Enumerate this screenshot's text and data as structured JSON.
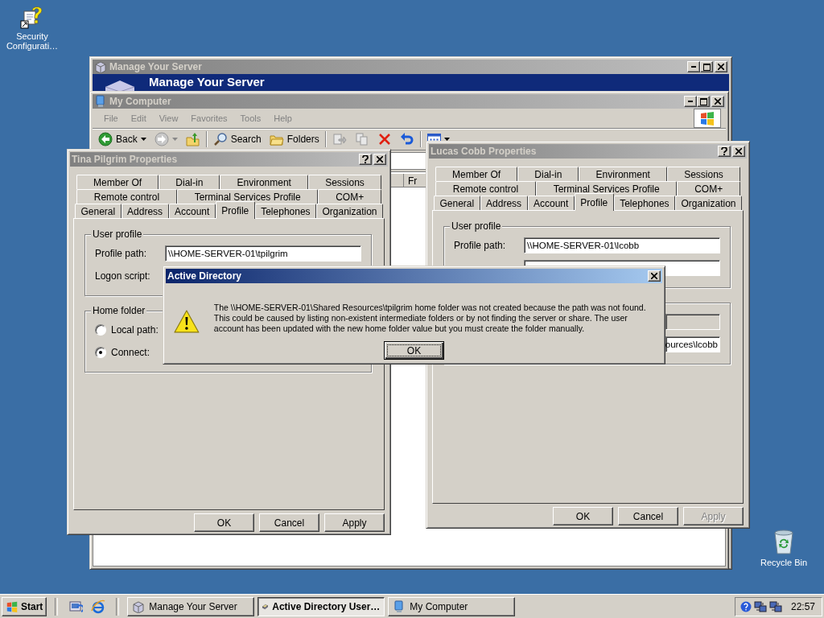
{
  "desktop": {
    "icons": [
      {
        "kind": "security",
        "label": "Security Configurati…"
      },
      {
        "kind": "recycle",
        "label": "Recycle Bin"
      }
    ]
  },
  "manage_your_server": {
    "title": "Manage Your Server",
    "banner_title": "Manage Your Server"
  },
  "my_computer": {
    "title": "My Computer",
    "menu": [
      "File",
      "Edit",
      "View",
      "Favorites",
      "Tools",
      "Help"
    ],
    "toolbar": [
      {
        "kind": "back",
        "label": "Back"
      },
      {
        "kind": "forward"
      },
      {
        "kind": "up"
      },
      {
        "kind": "separator"
      },
      {
        "kind": "search",
        "label": "Search"
      },
      {
        "kind": "folders",
        "label": "Folders"
      },
      {
        "kind": "separator"
      },
      {
        "kind": "move"
      },
      {
        "kind": "copy"
      },
      {
        "kind": "delete"
      },
      {
        "kind": "undo"
      },
      {
        "kind": "separator"
      },
      {
        "kind": "views"
      }
    ],
    "column_2": "Fr"
  },
  "dialogs": [
    {
      "title": "Tina Pilgrim Properties",
      "tab_rows": [
        [
          {
            "label": "Member Of",
            "selected": false
          },
          {
            "label": "Dial-in",
            "selected": false
          },
          {
            "label": "Environment",
            "selected": false
          },
          {
            "label": "Sessions",
            "selected": false
          }
        ],
        [
          {
            "label": "Remote control",
            "selected": false
          },
          {
            "label": "Terminal Services Profile",
            "selected": false
          },
          {
            "label": "COM+",
            "selected": false
          }
        ],
        [
          {
            "label": "General",
            "selected": false
          },
          {
            "label": "Address",
            "selected": false
          },
          {
            "label": "Account",
            "selected": false
          },
          {
            "label": "Profile",
            "selected": true
          },
          {
            "label": "Telephones",
            "selected": false
          },
          {
            "label": "Organization",
            "selected": false
          }
        ]
      ],
      "user_profile": {
        "label": "User profile",
        "items": [
          {
            "kind": "field",
            "label": "Profile path:",
            "value": "\\\\HOME-SERVER-01\\tpilgrim",
            "disabled": false
          },
          {
            "kind": "label",
            "label": "Logon script:"
          }
        ]
      },
      "home_folder": {
        "label": "Home folder",
        "items": [
          {
            "kind": "radio",
            "label": "Local path:",
            "selected": false
          },
          {
            "kind": "radio",
            "label": "Connect:",
            "selected": true
          }
        ]
      },
      "buttons": [
        {
          "label": "OK",
          "disabled": false
        },
        {
          "label": "Cancel",
          "disabled": false
        },
        {
          "label": "Apply",
          "disabled": false
        }
      ]
    },
    {
      "title": "Lucas Cobb Properties",
      "tab_rows": [
        [
          {
            "label": "Member Of",
            "selected": false
          },
          {
            "label": "Dial-in",
            "selected": false
          },
          {
            "label": "Environment",
            "selected": false
          },
          {
            "label": "Sessions",
            "selected": false
          }
        ],
        [
          {
            "label": "Remote control",
            "selected": false
          },
          {
            "label": "Terminal Services Profile",
            "selected": false
          },
          {
            "label": "COM+",
            "selected": false
          }
        ],
        [
          {
            "label": "General",
            "selected": false
          },
          {
            "label": "Address",
            "selected": false
          },
          {
            "label": "Account",
            "selected": false
          },
          {
            "label": "Profile",
            "selected": true
          },
          {
            "label": "Telephones",
            "selected": false
          },
          {
            "label": "Organization",
            "selected": false
          }
        ]
      ],
      "user_profile": {
        "label": "User profile",
        "items": [
          {
            "kind": "field",
            "label": "Profile path:",
            "value": "\\\\HOME-SERVER-01\\lcobb",
            "disabled": false
          },
          {
            "kind": "field",
            "disabled": false
          }
        ]
      },
      "home_folder": {
        "items": [
          {
            "kind": "field",
            "disabled": true
          },
          {
            "kind": "field",
            "value": "ources\\lcobb",
            "disabled": false
          }
        ]
      },
      "buttons": [
        {
          "label": "OK",
          "disabled": false
        },
        {
          "label": "Cancel",
          "disabled": false
        },
        {
          "label": "Apply",
          "disabled": true
        }
      ]
    }
  ],
  "message_box": {
    "title": "Active Directory",
    "text": "The \\\\HOME-SERVER-01\\Shared Resources\\tpilgrim home folder was not created because the path was not found. This could be caused by listing non-existent intermediate folders or by not finding the server or share. The user account has been updated with the new home folder value but you must create the folder manually.",
    "button": "OK"
  },
  "taskbar": {
    "start": "Start",
    "quick_launch": [
      {
        "kind": "desktop"
      },
      {
        "kind": "browser"
      }
    ],
    "tasks": [
      {
        "kind": "server",
        "label": "Manage Your Server",
        "selected": false
      },
      {
        "kind": "directory",
        "label": "Active Directory User…",
        "selected": true
      },
      {
        "kind": "computer",
        "label": "My Computer",
        "selected": false
      }
    ],
    "tray": [
      {
        "kind": "help"
      },
      {
        "kind": "network"
      },
      {
        "kind": "network"
      }
    ],
    "clock": "22:57"
  }
}
